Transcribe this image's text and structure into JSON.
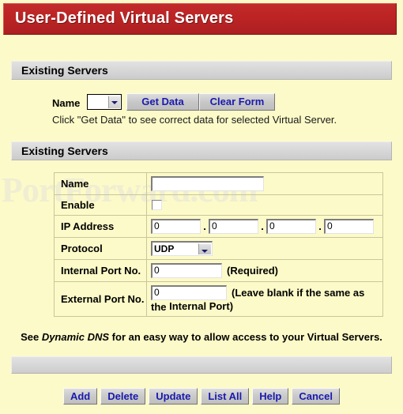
{
  "page": {
    "background_color": "#FCFAC8",
    "watermark": "PortForward.com"
  },
  "titlebar": {
    "title": "User-Defined Virtual Servers",
    "background_color": "#BC2424",
    "text_color": "#FFFFFF"
  },
  "sections": {
    "existing_servers_top": "Existing Servers",
    "existing_servers_bottom": "Existing Servers",
    "footer_bar": ""
  },
  "top_form": {
    "name_label": "Name",
    "name_select_value": "",
    "get_data_label": "Get Data",
    "clear_form_label": "Clear Form",
    "hint": "Click \"Get Data\" to see correct data for selected Virtual Server."
  },
  "server_form": {
    "rows": {
      "name": {
        "label": "Name",
        "value": ""
      },
      "enable": {
        "label": "Enable",
        "checked": false
      },
      "ip_address": {
        "label": "IP Address",
        "octet1": "0",
        "octet2": "0",
        "octet3": "0",
        "octet4": "0",
        "separator": "."
      },
      "protocol": {
        "label": "Protocol",
        "value": "UDP"
      },
      "internal_port": {
        "label": "Internal Port No.",
        "value": "0",
        "note": "(Required)"
      },
      "external_port": {
        "label": "External Port No.",
        "value": "0",
        "note_line1": "(Leave blank if the same as the",
        "note_line2": "Internal Port)"
      }
    }
  },
  "dns_note": {
    "prefix": "See ",
    "emphasis": "Dynamic DNS",
    "suffix": " for an easy way to allow access to your Virtual Servers."
  },
  "footer": {
    "buttons": [
      {
        "label": "Add"
      },
      {
        "label": "Delete"
      },
      {
        "label": "Update"
      },
      {
        "label": "List All"
      },
      {
        "label": "Help"
      },
      {
        "label": "Cancel"
      }
    ],
    "button_text_color": "#1A1AAE"
  }
}
